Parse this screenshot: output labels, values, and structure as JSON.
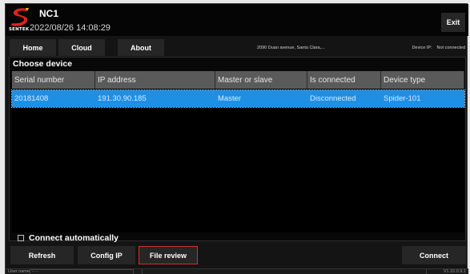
{
  "app": {
    "name": "NC1",
    "brand": "SENTEK",
    "datetime": "2022/08/26 14:08:29",
    "exit_label": "Exit"
  },
  "nav": {
    "tabs": [
      {
        "label": "Home"
      },
      {
        "label": "Cloud"
      },
      {
        "label": "About"
      }
    ],
    "address": "2090 Duan avenue, Santa Clara,...",
    "device_ip_label": "Device IP:",
    "device_ip_value": "Not connected"
  },
  "panel": {
    "title": "Choose device",
    "columns": [
      "Serial number",
      "IP address",
      "Master or slave",
      "Is connected",
      "Device type"
    ],
    "rows": [
      {
        "serial": "20181408",
        "ip": "191.30.90.185",
        "role": "Master",
        "connected": "Disconnected",
        "type": "Spider-101"
      }
    ]
  },
  "connect_automatically": {
    "label": "Connect automatically",
    "checked": false
  },
  "buttons": {
    "refresh": "Refresh",
    "config_ip": "Config IP",
    "file_review": "File review",
    "connect": "Connect"
  },
  "status": {
    "user_label": "User name:",
    "user_value": "- - -",
    "version": "V1.10.0.9.1"
  },
  "colors": {
    "selected_row": "#1f8fe4",
    "highlight_border": "#d0312d",
    "logo_red": "#e2231a",
    "logo_yellow": "#f2c200"
  },
  "icons": {
    "logo": "sentek-s-logo",
    "checkbox": "checkbox-unchecked"
  }
}
